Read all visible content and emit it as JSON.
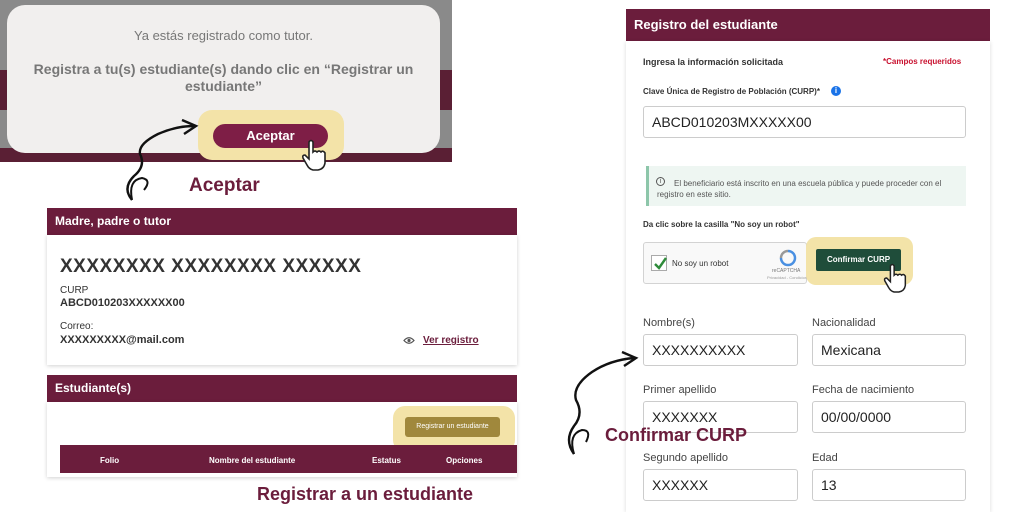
{
  "modal": {
    "line1": "Ya estás registrado como tutor.",
    "line2": "Registra a tu(s) estudiante(s) dando clic en “Registrar un estudiante”",
    "accept_button": "Aceptar"
  },
  "annotations": {
    "aceptar": "Aceptar",
    "registrar": "Registrar a un estudiante",
    "confirmar": "Confirmar CURP"
  },
  "tutor_section": {
    "title": "Madre, padre o tutor",
    "name": "XXXXXXXX XXXXXXXX XXXXXX",
    "curp_label": "CURP",
    "curp_value": "ABCD010203XXXXXX00",
    "email_label": "Correo:",
    "email_value": "XXXXXXXXX@mail.com",
    "view_link": "Ver registro"
  },
  "students_section": {
    "title": "Estudiante(s)",
    "register_button": "Registrar un estudiante",
    "columns": [
      "Folio",
      "Nombre del estudiante",
      "Estatus",
      "Opciones"
    ]
  },
  "student_form": {
    "title": "Registro del estudiante",
    "instruction": "Ingresa la información solicitada",
    "required_note": "*Campos requeridos",
    "curp_label": "Clave Única de Registro de Población (CURP)*",
    "curp_value": "ABCD010203MXXXXX00",
    "info_message": "El beneficiario está inscrito en una escuela pública y puede proceder con el registro en este sitio.",
    "captcha_prompt": "Da clic sobre la casilla \"No soy un robot\"",
    "captcha_label": "No soy un robot",
    "captcha_brand": "reCAPTCHA",
    "captcha_links": "Privacidad - Condiciones",
    "confirm_button": "Confirmar CURP",
    "fields": {
      "nombres_label": "Nombre(s)",
      "nombres_value": "XXXXXXXXXX",
      "nacionalidad_label": "Nacionalidad",
      "nacionalidad_value": "Mexicana",
      "primer_apellido_label": "Primer apellido",
      "primer_apellido_value": "XXXXXXX",
      "fecha_label": "Fecha de nacimiento",
      "fecha_value": "00/00/0000",
      "segundo_apellido_label": "Segundo apellido",
      "segundo_apellido_value": "XXXXXX",
      "edad_label": "Edad",
      "edad_value": "13"
    }
  },
  "colors": {
    "brand_maroon": "#6b1d3c",
    "highlight": "#f3e3a8",
    "confirm_green": "#1f4d3a",
    "register_gold": "#a0883c"
  }
}
